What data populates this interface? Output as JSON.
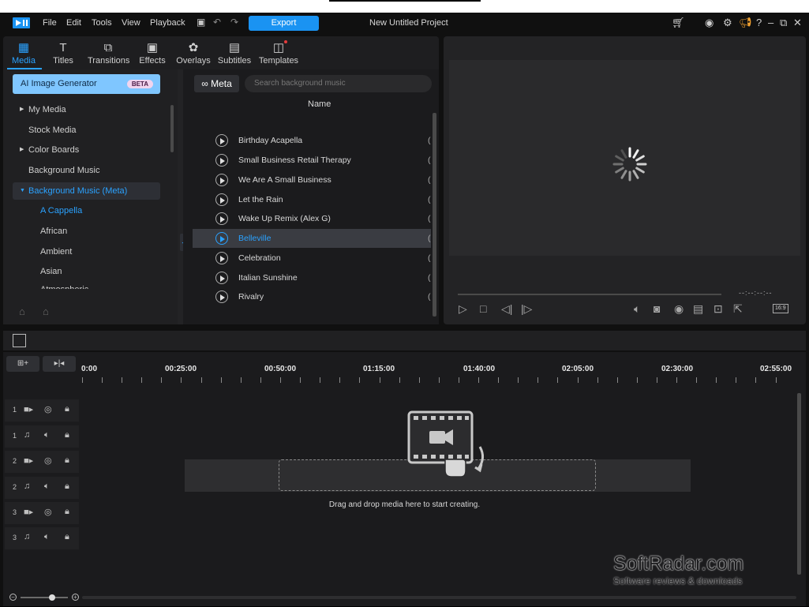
{
  "menubar": {
    "items": [
      "File",
      "Edit",
      "Tools",
      "View",
      "Playback"
    ],
    "export_label": "Export",
    "project_title": "New Untitled Project"
  },
  "tabs": [
    {
      "label": "Media",
      "icon": "media-icon",
      "glyph": "▦"
    },
    {
      "label": "Titles",
      "icon": "titles-icon",
      "glyph": "T"
    },
    {
      "label": "Transitions",
      "icon": "transitions-icon",
      "glyph": "⧉"
    },
    {
      "label": "Effects",
      "icon": "effects-icon",
      "glyph": "▣"
    },
    {
      "label": "Overlays",
      "icon": "overlays-icon",
      "glyph": "✿"
    },
    {
      "label": "Subtitles",
      "icon": "subtitles-icon",
      "glyph": "▤"
    },
    {
      "label": "Templates",
      "icon": "templates-icon",
      "glyph": "◫"
    }
  ],
  "sidebar": {
    "ai_button": "AI Image Generator",
    "beta": "BETA",
    "items": [
      {
        "label": "My Media",
        "arrow": "▶"
      },
      {
        "label": "Stock Media",
        "arrow": ""
      },
      {
        "label": "Color Boards",
        "arrow": "▶"
      },
      {
        "label": "Background Music",
        "arrow": ""
      },
      {
        "label": "Background Music (Meta)",
        "arrow": "▼"
      }
    ],
    "subitems": [
      "A Cappella",
      "African",
      "Ambient",
      "Asian",
      "Atmospheric"
    ]
  },
  "content": {
    "source_label": "Meta",
    "search_placeholder": "Search background music",
    "column_header": "Name",
    "tracks": [
      "Birthday Acapella",
      "Small Business Retail Therapy",
      "We Are A Small Business",
      "Let the Rain",
      "Wake Up Remix (Alex G)",
      "Belleville",
      "Celebration",
      "Italian Sunshine",
      "Rivalry"
    ],
    "selected_track": "Belleville"
  },
  "preview": {
    "timecode": "--:--:--:--",
    "aspect": "16:9"
  },
  "timeline": {
    "ruler": [
      "0:00",
      "00:25:00",
      "00:50:00",
      "01:15:00",
      "01:40:00",
      "02:05:00",
      "02:30:00",
      "02:55:00"
    ],
    "tracks": [
      "1",
      "1",
      "2",
      "2",
      "3",
      "3"
    ],
    "drop_text": "Drag and drop media here to start creating."
  },
  "watermark": {
    "title": "SoftRadar.com",
    "subtitle": "Software reviews & downloads"
  },
  "colors": {
    "accent": "#2aa2ff",
    "export": "#1a93f2",
    "ai_button": "#7fc6ff",
    "background": "#101010"
  }
}
